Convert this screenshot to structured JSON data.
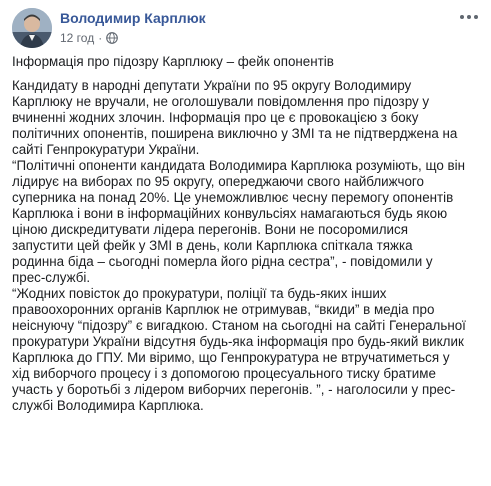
{
  "post": {
    "author": "Володимир Карплюк",
    "timestamp": "12 год",
    "separator": "·",
    "privacy_icon": "globe-icon",
    "more_icon": "ellipsis-icon",
    "headline": "Інформація про підозру Карплюку – фейк опонентів",
    "body": "Кандидату в народні депутати України по 95 округу Володимиру\nКарплюку не вручали, не оголошували повідомлення про підозру у\nвчиненні жодних злочин. Інформація про це є провокацією з боку\nполітичних опонентів, поширена виключно у ЗМІ та не підтверджена на\nсайті Генпрокуратури України.\n“Політичні опоненти кандидата Володимира Карплюка розуміють, що він\nлідирує на виборах по 95 округу, опереджаючи свого найближчого\nсуперника на понад 20%. Це унеможливлює чесну перемогу опонентів\nКарплюка і вони в інформаційних конвульсіях намагаються будь якою\nціною дискредитувати лідера перегонів. Вони не посоромилися\nзапустити цей фейк у ЗМІ в день, коли Карплюка спіткала тяжка\nродинна біда – сьогодні померла його рідна сестра”, - повідомили у\nпрес-службі.\n“Жодних повісток до прокуратури, поліції та будь-яких інших\nправоохоронних органів Карплюк не отримував, “вкиди” в медіа про\nнеіснуючу “підозру” є вигадкою. Станом на сьогодні на сайті Генеральної\nпрокуратури України відсутня будь-яка інформація про будь-який виклик\nКарплюка до ГПУ. Ми віримо, що Генпрокуратура не втручатиметься у\nхід виборчого процесу і з допомогою процесуального тиску братиме\nучасть у боротьбі з лідером виборчих перегонів. ”, - наголосили у прес-\nслужбі Володимира Карплюка."
  },
  "colors": {
    "author": "#385898",
    "meta": "#616770",
    "text": "#1c1e21",
    "background": "#ffffff"
  }
}
